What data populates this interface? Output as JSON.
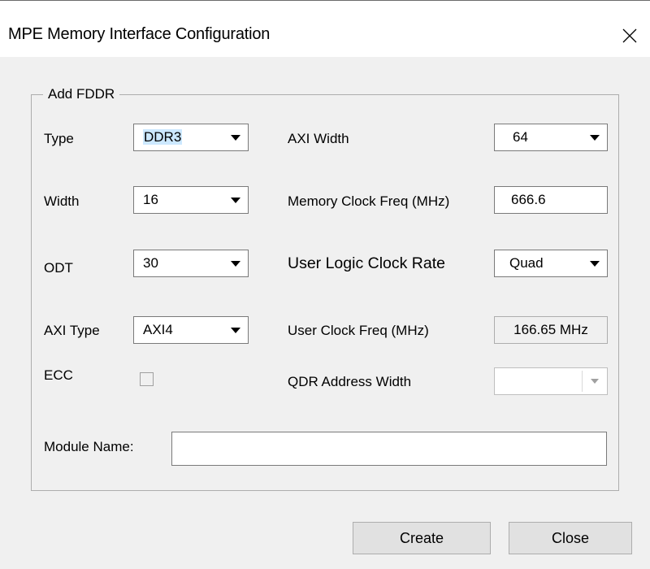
{
  "window": {
    "title": "MPE Memory Interface Configuration"
  },
  "group": {
    "legend": "Add FDDR"
  },
  "fields": {
    "type": {
      "label": "Type",
      "value": "DDR3"
    },
    "width": {
      "label": "Width",
      "value": "16"
    },
    "odt": {
      "label": "ODT",
      "value": "30"
    },
    "axi_type": {
      "label": "AXI Type",
      "value": "AXI4"
    },
    "ecc": {
      "label": "ECC",
      "checked": false
    },
    "axi_width": {
      "label": "AXI Width",
      "value": "64"
    },
    "mem_clock_freq": {
      "label": "Memory Clock Freq (MHz)",
      "value": "666.6"
    },
    "user_logic_clock_rate": {
      "label": "User Logic Clock Rate",
      "value": "Quad"
    },
    "user_clock_freq": {
      "label": "User Clock Freq (MHz)",
      "value": "166.65 MHz"
    },
    "qdr_address_width": {
      "label": "QDR Address Width",
      "value": ""
    },
    "module_name": {
      "label": "Module Name:",
      "value": ""
    }
  },
  "buttons": {
    "create": "Create",
    "close": "Close"
  },
  "icons": {
    "close": "close-icon",
    "dropdown": "chevron-down-icon"
  }
}
